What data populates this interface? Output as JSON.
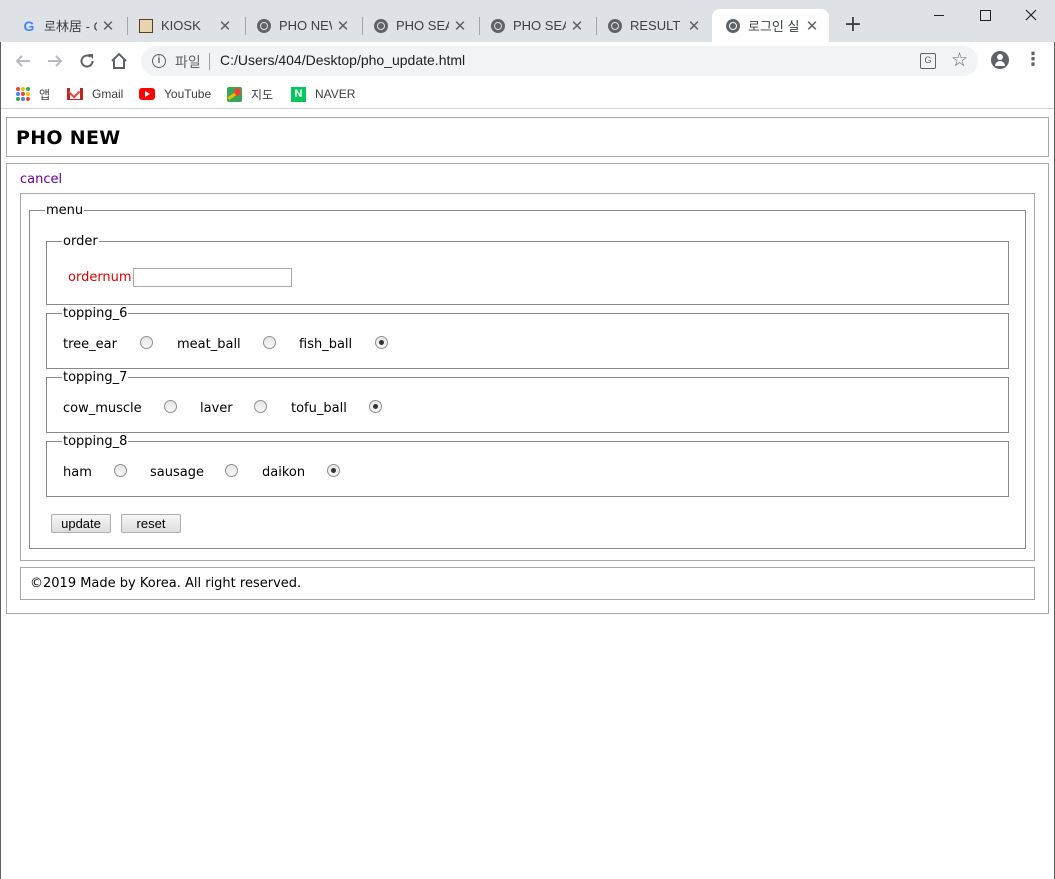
{
  "browser": {
    "tabs": [
      {
        "label": "로林居 - Google",
        "icon": "google-icon",
        "active": false
      },
      {
        "label": "KIOSK",
        "icon": "kiosk-icon",
        "active": false
      },
      {
        "label": "PHO NEW",
        "icon": "globe-icon",
        "active": false
      },
      {
        "label": "PHO SEARCH",
        "icon": "globe-icon",
        "active": false
      },
      {
        "label": "PHO SEARCH",
        "icon": "globe-icon",
        "active": false
      },
      {
        "label": "RESULT",
        "icon": "globe-icon",
        "active": false
      },
      {
        "label": "로그인 실",
        "icon": "globe-icon",
        "active": true
      }
    ],
    "tab_close_glyph": "✕",
    "new_tab_glyph": "+",
    "address": {
      "scheme_label": "파일",
      "url": "C:/Users/404/Desktop/pho_update.html"
    },
    "bookmarks": [
      {
        "label": "앱",
        "icon": "apps-grid-icon"
      },
      {
        "label": "Gmail",
        "icon": "gmail-icon"
      },
      {
        "label": "YouTube",
        "icon": "youtube-icon"
      },
      {
        "label": "지도",
        "icon": "maps-icon"
      },
      {
        "label": "NAVER",
        "icon": "naver-icon"
      }
    ]
  },
  "page": {
    "title": "PHO NEW",
    "cancel_link": "cancel",
    "form": {
      "outer_legend": "menu",
      "order": {
        "legend": "order",
        "field_label": "ordernum",
        "field_value": ""
      },
      "topping_6": {
        "legend": "topping_6",
        "options": [
          "tree_ear",
          "meat_ball",
          "fish_ball"
        ],
        "selected": "fish_ball"
      },
      "topping_7": {
        "legend": "topping_7",
        "options": [
          "cow_muscle",
          "laver",
          "tofu_ball"
        ],
        "selected": "tofu_ball"
      },
      "topping_8": {
        "legend": "topping_8",
        "options": [
          "ham",
          "sausage",
          "daikon"
        ],
        "selected": "daikon"
      },
      "buttons": {
        "update": "update",
        "reset": "reset"
      }
    },
    "footer": "©2019 Made by Korea. All right reserved."
  }
}
